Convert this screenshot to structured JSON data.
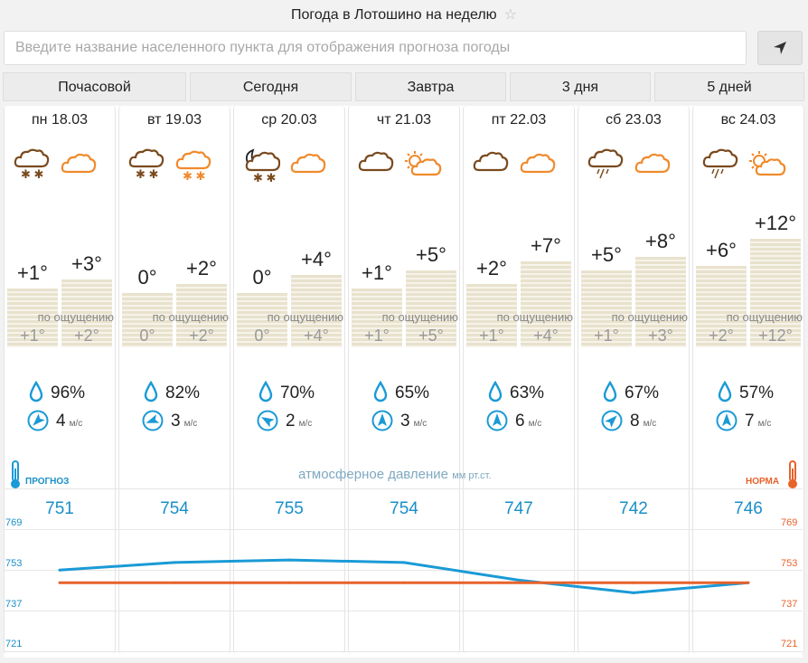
{
  "page_title": "Погода в Лотошино на неделю",
  "search": {
    "placeholder": "Введите название населенного пункта для отображения прогноза погоды"
  },
  "tabs": [
    "Почасовой",
    "Сегодня",
    "Завтра",
    "3 дня",
    "5 дней"
  ],
  "feels_like_label": "по ощущению",
  "days": [
    {
      "date": "пн 18.03",
      "night_icon": "cloud-snow-icon",
      "day_icon": "cloud-icon",
      "t_night": "+1°",
      "t_day": "+3°",
      "feel_night": "+1°",
      "feel_day": "+2°",
      "humidity": "96%",
      "wind": "4",
      "wind_dir_deg": 225,
      "pressure": "751"
    },
    {
      "date": "вт 19.03",
      "night_icon": "cloud-snow-icon",
      "day_icon": "cloud-snow-icon",
      "t_night": "0°",
      "t_day": "+2°",
      "feel_night": "0°",
      "feel_day": "+2°",
      "humidity": "82%",
      "wind": "3",
      "wind_dir_deg": 250,
      "pressure": "754"
    },
    {
      "date": "ср 20.03",
      "night_icon": "moon-cloud-snow-icon",
      "day_icon": "cloud-icon",
      "t_night": "0°",
      "t_day": "+4°",
      "feel_night": "0°",
      "feel_day": "+4°",
      "humidity": "70%",
      "wind": "2",
      "wind_dir_deg": 300,
      "pressure": "755"
    },
    {
      "date": "чт 21.03",
      "night_icon": "cloud-icon",
      "day_icon": "sun-cloud-icon",
      "t_night": "+1°",
      "t_day": "+5°",
      "feel_night": "+1°",
      "feel_day": "+5°",
      "humidity": "65%",
      "wind": "3",
      "wind_dir_deg": 0,
      "pressure": "754"
    },
    {
      "date": "пт 22.03",
      "night_icon": "cloud-icon",
      "day_icon": "cloud-icon",
      "t_night": "+2°",
      "t_day": "+7°",
      "feel_night": "+1°",
      "feel_day": "+4°",
      "humidity": "63%",
      "wind": "6",
      "wind_dir_deg": 0,
      "pressure": "747"
    },
    {
      "date": "сб 23.03",
      "night_icon": "cloud-rain-icon",
      "day_icon": "cloud-icon",
      "t_night": "+5°",
      "t_day": "+8°",
      "feel_night": "+1°",
      "feel_day": "+3°",
      "humidity": "67%",
      "wind": "8",
      "wind_dir_deg": 45,
      "pressure": "742"
    },
    {
      "date": "вс 24.03",
      "night_icon": "cloud-rain-icon",
      "day_icon": "sun-cloud-icon",
      "t_night": "+6°",
      "t_day": "+12°",
      "feel_night": "+2°",
      "feel_day": "+12°",
      "humidity": "57%",
      "wind": "7",
      "wind_dir_deg": 0,
      "pressure": "746"
    }
  ],
  "wind_unit": "м/с",
  "pressure_label": "атмосферное давление",
  "pressure_unit": "мм рт.ст.",
  "forecast_label": "ПРОГНОЗ",
  "norm_label": "НОРМА",
  "axis_ticks": [
    "769",
    "753",
    "737",
    "721"
  ],
  "chart_data": {
    "type": "line",
    "x": [
      "пн 18.03",
      "вт 19.03",
      "ср 20.03",
      "чт 21.03",
      "пт 22.03",
      "сб 23.03",
      "вс 24.03"
    ],
    "series": [
      {
        "name": "ПРОГНОЗ",
        "values": [
          751,
          754,
          755,
          754,
          747,
          742,
          746
        ],
        "color": "#1a9ad6"
      },
      {
        "name": "НОРМА",
        "values": [
          746,
          746,
          746,
          746,
          746,
          746,
          746
        ],
        "color": "#e8622a"
      }
    ],
    "ylim": [
      721,
      769
    ]
  },
  "colors": {
    "accent_blue": "#1a9ad6",
    "accent_orange": "#e8622a",
    "icon_brown": "#7a4a1e",
    "icon_orange": "#f08a2c"
  }
}
